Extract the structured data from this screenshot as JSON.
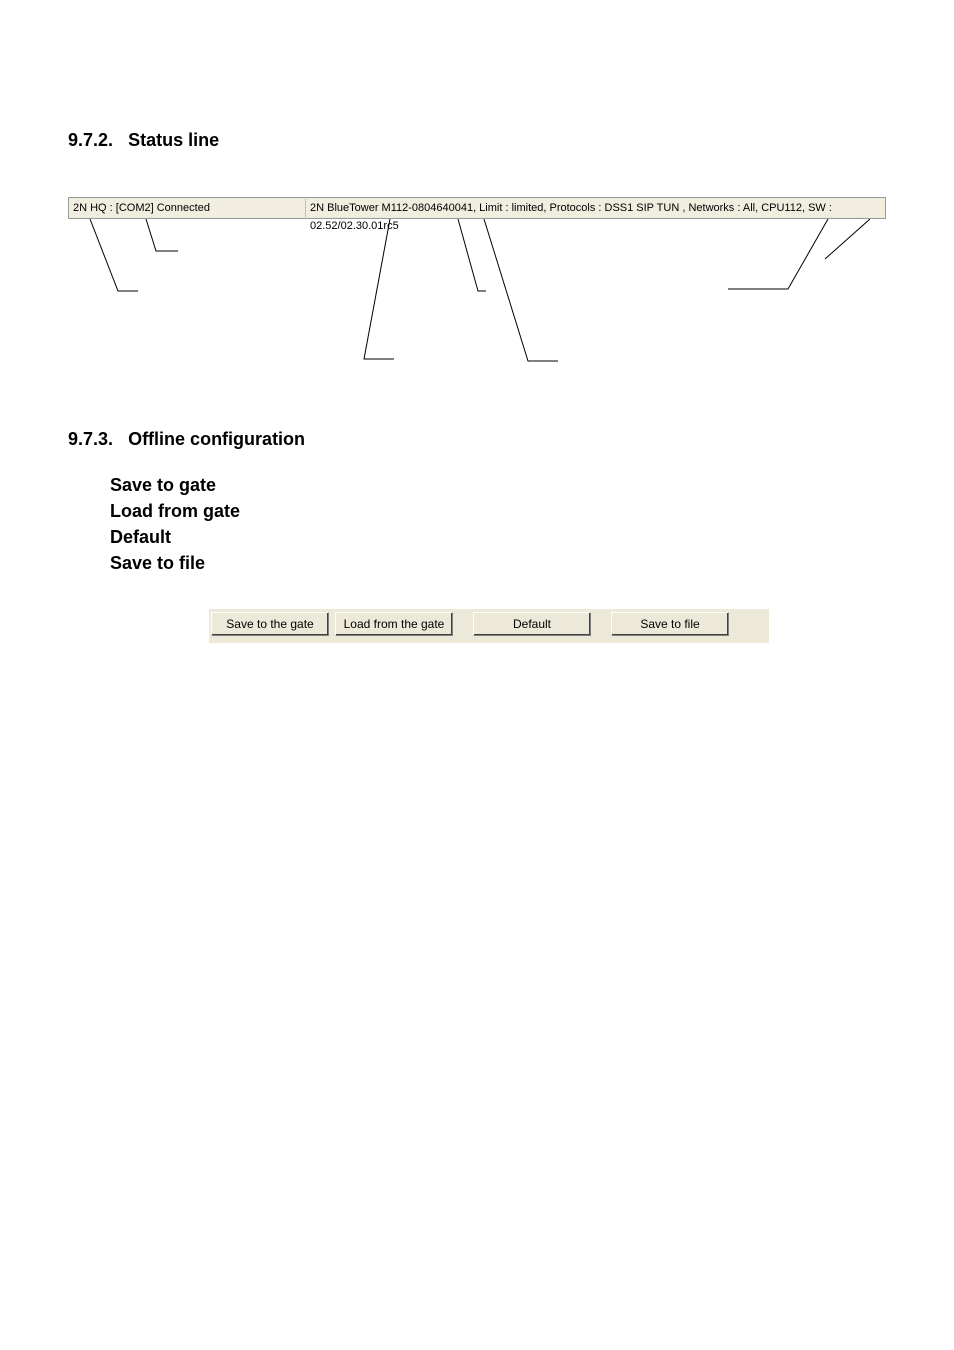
{
  "headings": {
    "s1_num": "9.7.2.",
    "s1_title": "Status line",
    "s2_num": "9.7.3.",
    "s2_title": "Offline configuration"
  },
  "statusbar": {
    "left": "2N HQ : [COM2] Connected",
    "right": "2N BlueTower M112-0804640041, Limit : limited, Protocols : DSS1 SIP TUN , Networks : All, CPU112, SW : 02.52/02.30.01rc5"
  },
  "options": [
    "Save to gate",
    "Load from gate",
    "Default",
    "Save to file"
  ],
  "buttons": {
    "save_to_gate": "Save to the gate",
    "load_from_gate": "Load from the gate",
    "default": "Default",
    "save_to_file": "Save to file"
  }
}
